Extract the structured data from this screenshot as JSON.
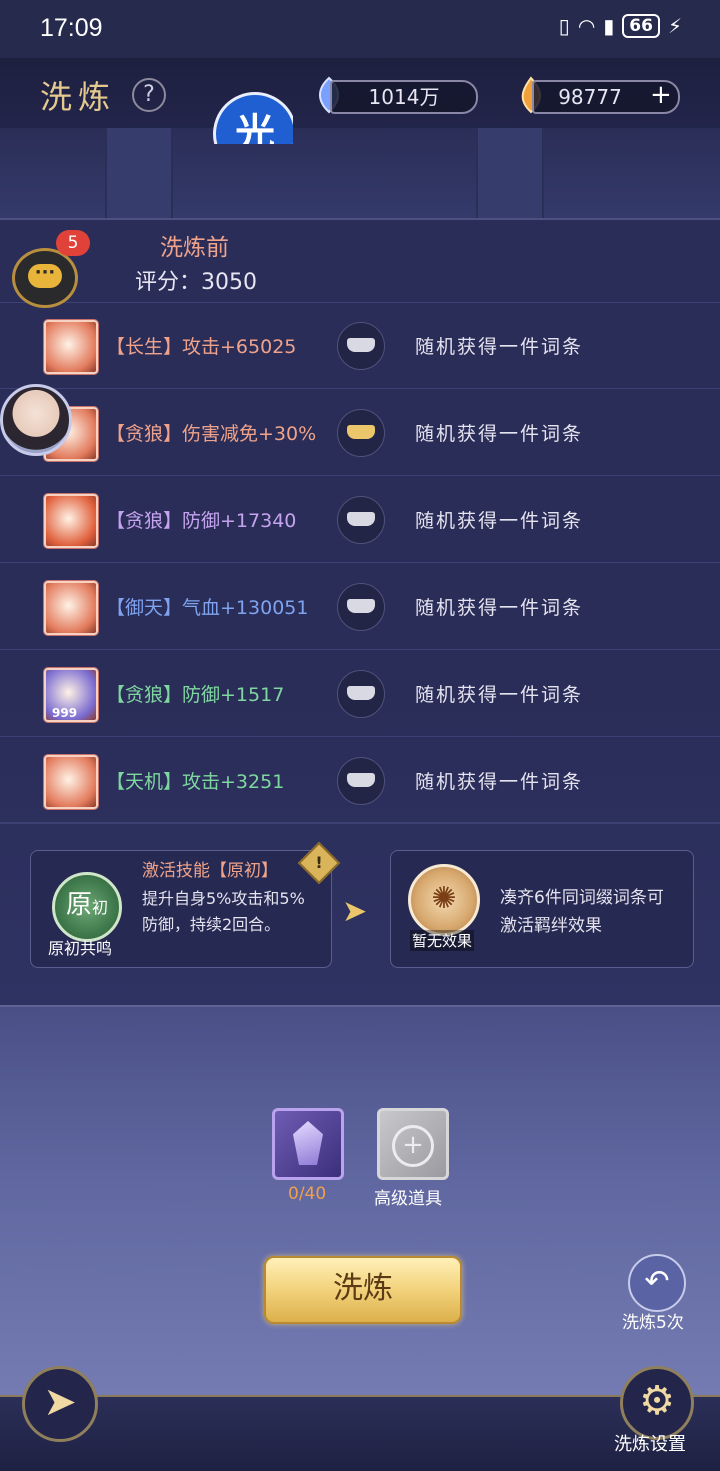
{
  "status_bar": {
    "time": "17:09",
    "battery": "66"
  },
  "header": {
    "title": "洗炼",
    "help": "?",
    "currency_a": "1014万",
    "currency_b": "98777",
    "add": "+",
    "element_badge": "光"
  },
  "panel": {
    "before_label": "洗炼前",
    "score_label": "评分：",
    "score_value": "3050"
  },
  "rows": [
    {
      "prefix": "【长生】",
      "stat": "攻击+65025",
      "color": "#f0a38a",
      "icon_color": "#e27a5c",
      "lock": "silver",
      "desc": "随机获得一件词条"
    },
    {
      "prefix": "【贪狼】",
      "stat": "伤害减免+30%",
      "color": "#f0a38a",
      "icon_color": "#e27a5c",
      "lock": "gold",
      "desc": "随机获得一件词条"
    },
    {
      "prefix": "【贪狼】",
      "stat": "防御+17340",
      "color": "#c6a3ef",
      "icon_color": "#e0603c",
      "lock": "silver",
      "desc": "随机获得一件词条"
    },
    {
      "prefix": "【御天】",
      "stat": "气血+130051",
      "color": "#7fa3ef",
      "icon_color": "#e27a5c",
      "lock": "silver",
      "desc": "随机获得一件词条"
    },
    {
      "prefix": "【贪狼】",
      "stat": "防御+1517",
      "color": "#7fd7a0",
      "icon_color": "#7a6bd0",
      "lock": "silver",
      "desc": "随机获得一件词条",
      "icon_count": "999"
    },
    {
      "prefix": "【天机】",
      "stat": "攻击+3251",
      "color": "#7fd7a0",
      "icon_color": "#e27a5c",
      "lock": "silver",
      "desc": "随机获得一件词条"
    }
  ],
  "skill": {
    "title": "激活技能【原初】",
    "desc": "提升自身5%攻击和5%防御，持续2回合。",
    "icon_big": "原",
    "icon_small": "初",
    "label": "原初共鸣",
    "warn": "!"
  },
  "bond": {
    "icon_label": "暂无效果",
    "desc": "凑齐6件同词缀词条可激活羁绊效果"
  },
  "items": {
    "crystal_count": "0/40",
    "advanced_label": "高级道具"
  },
  "buttons": {
    "wash": "洗炼",
    "wash_five": "洗炼5次",
    "settings": "洗炼设置"
  },
  "chat": {
    "badge": "5"
  }
}
